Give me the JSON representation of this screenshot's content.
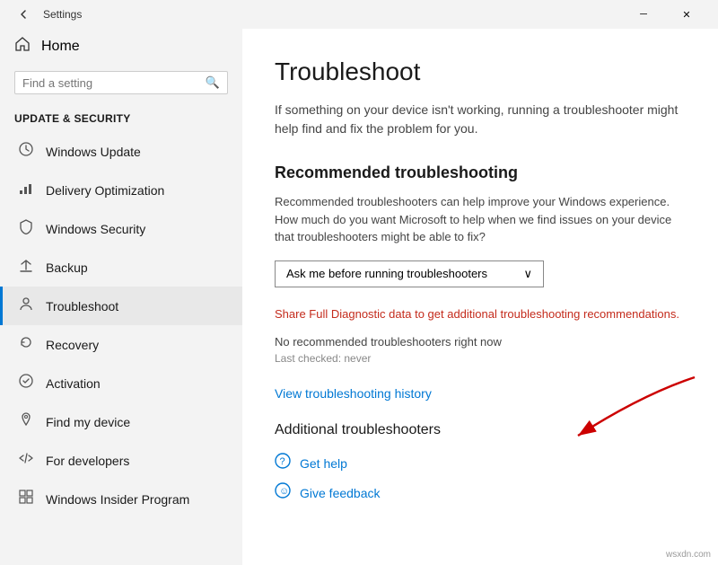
{
  "titlebar": {
    "title": "Settings",
    "back_label": "←",
    "minimize_label": "─",
    "close_label": "✕"
  },
  "sidebar": {
    "home_label": "Home",
    "search_placeholder": "Find a setting",
    "section_title": "Update & Security",
    "nav_items": [
      {
        "id": "windows-update",
        "label": "Windows Update",
        "icon": "↻"
      },
      {
        "id": "delivery-optimization",
        "label": "Delivery Optimization",
        "icon": "📊"
      },
      {
        "id": "windows-security",
        "label": "Windows Security",
        "icon": "🛡"
      },
      {
        "id": "backup",
        "label": "Backup",
        "icon": "↑"
      },
      {
        "id": "troubleshoot",
        "label": "Troubleshoot",
        "icon": "👤",
        "active": true
      },
      {
        "id": "recovery",
        "label": "Recovery",
        "icon": "↩"
      },
      {
        "id": "activation",
        "label": "Activation",
        "icon": "✅"
      },
      {
        "id": "find-my-device",
        "label": "Find my device",
        "icon": "📍"
      },
      {
        "id": "for-developers",
        "label": "For developers",
        "icon": "👨‍💻"
      },
      {
        "id": "windows-insider",
        "label": "Windows Insider Program",
        "icon": "🪟"
      }
    ]
  },
  "main": {
    "page_title": "Troubleshoot",
    "page_desc": "If something on your device isn't working, running a troubleshooter might help find and fix the problem for you.",
    "recommended_section_title": "Recommended troubleshooting",
    "recommended_desc": "Recommended troubleshooters can help improve your Windows experience. How much do you want Microsoft to help when we find issues on your device that troubleshooters might be able to fix?",
    "dropdown_value": "Ask me before running troubleshooters",
    "dropdown_arrow": "⌵",
    "share_link": "Share Full Diagnostic data to get additional troubleshooting recommendations.",
    "status_text": "No recommended troubleshooters right now",
    "last_checked": "Last checked: never",
    "view_history_link": "View troubleshooting history",
    "additional_section_title": "Additional troubleshooters",
    "get_help_label": "Get help",
    "give_feedback_label": "Give feedback"
  },
  "watermark": "wsxdn.com"
}
